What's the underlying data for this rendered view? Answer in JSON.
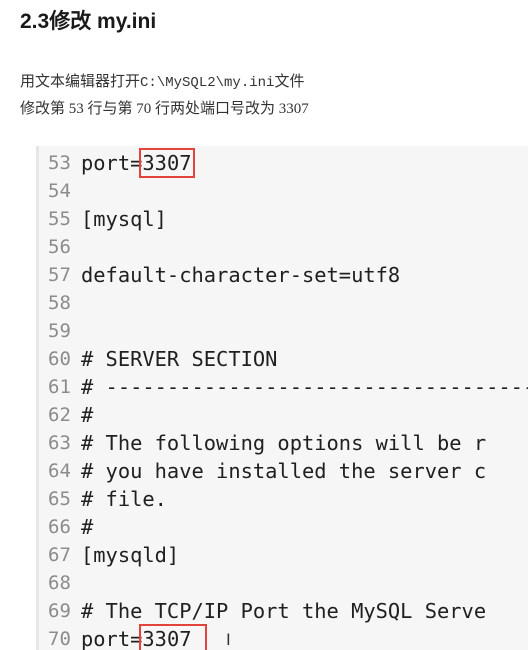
{
  "heading": "2.3修改 my.ini",
  "paragraph1": {
    "before": "用文本编辑器打开",
    "path": "C:\\MySQL2\\my.ini",
    "after": "文件"
  },
  "paragraph2": "修改第 53 行与第 70 行两处端口号改为 3307",
  "code_lines": [
    {
      "num": "53",
      "pre": "port=",
      "hl": "3307",
      "post": ""
    },
    {
      "num": "54",
      "pre": "",
      "hl": "",
      "post": ""
    },
    {
      "num": "55",
      "pre": "[mysql]",
      "hl": "",
      "post": ""
    },
    {
      "num": "56",
      "pre": "",
      "hl": "",
      "post": ""
    },
    {
      "num": "57",
      "pre": "default-character-set=utf8",
      "hl": "",
      "post": ""
    },
    {
      "num": "58",
      "pre": "",
      "hl": "",
      "post": ""
    },
    {
      "num": "59",
      "pre": "",
      "hl": "",
      "post": ""
    },
    {
      "num": "60",
      "pre": "# SERVER SECTION",
      "hl": "",
      "post": ""
    },
    {
      "num": "61",
      "pre": "# ----------------------------------------",
      "hl": "",
      "post": ""
    },
    {
      "num": "62",
      "pre": "#",
      "hl": "",
      "post": ""
    },
    {
      "num": "63",
      "pre": "# The following options will be r",
      "hl": "",
      "post": ""
    },
    {
      "num": "64",
      "pre": "# you have installed the server c",
      "hl": "",
      "post": ""
    },
    {
      "num": "65",
      "pre": "# file.",
      "hl": "",
      "post": ""
    },
    {
      "num": "66",
      "pre": "#",
      "hl": "",
      "post": ""
    },
    {
      "num": "67",
      "pre": "[mysqld]",
      "hl": "",
      "post": ""
    },
    {
      "num": "68",
      "pre": "",
      "hl": "",
      "post": ""
    },
    {
      "num": "69",
      "pre": "# The TCP/IP Port the MySQL Serve",
      "hl": "",
      "post": ""
    },
    {
      "num": "70",
      "pre": "port=",
      "hl": "3307 ",
      "post": ""
    }
  ],
  "highlight_color": "#e0443a",
  "cursor_icon": "text-cursor-icon"
}
